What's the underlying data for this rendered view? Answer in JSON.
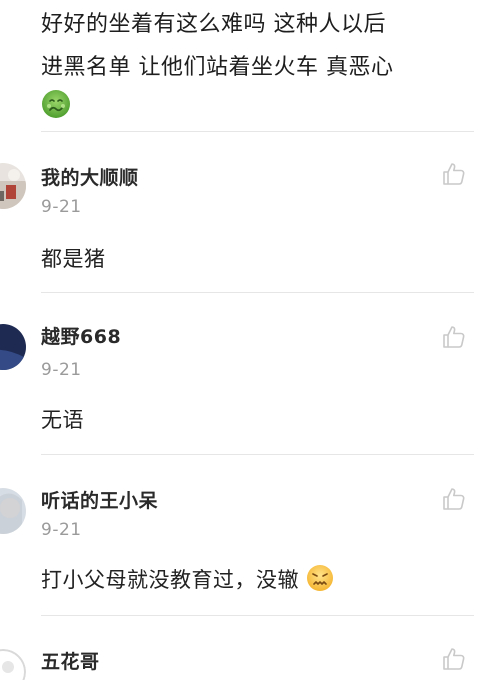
{
  "post": {
    "line1": "好好的坐着有这么难吗 这种人以后",
    "line2": "进黑名单 让他们站着坐火车 真恶心",
    "emoji": "nauseated-face-emoji"
  },
  "comments": [
    {
      "user": "我的大顺顺",
      "date": "9-21",
      "text": "都是猪",
      "avatar": "avatar-1"
    },
    {
      "user": "越野668",
      "date": "9-21",
      "text": "无语",
      "avatar": "avatar-2"
    },
    {
      "user": "听话的王小呆",
      "date": "9-21",
      "text": "打小父母就没教育过，没辙",
      "emoji": "frustrated-face-emoji",
      "avatar": "avatar-3"
    },
    {
      "user": "五花哥",
      "avatar": "avatar-4"
    }
  ],
  "icons": {
    "like": "thumbs-up-icon"
  },
  "colors": {
    "text": "#1f1f1f",
    "muted": "#9a9a9a",
    "divider": "#e6e6e6",
    "like_icon": "#c9c9c9"
  }
}
